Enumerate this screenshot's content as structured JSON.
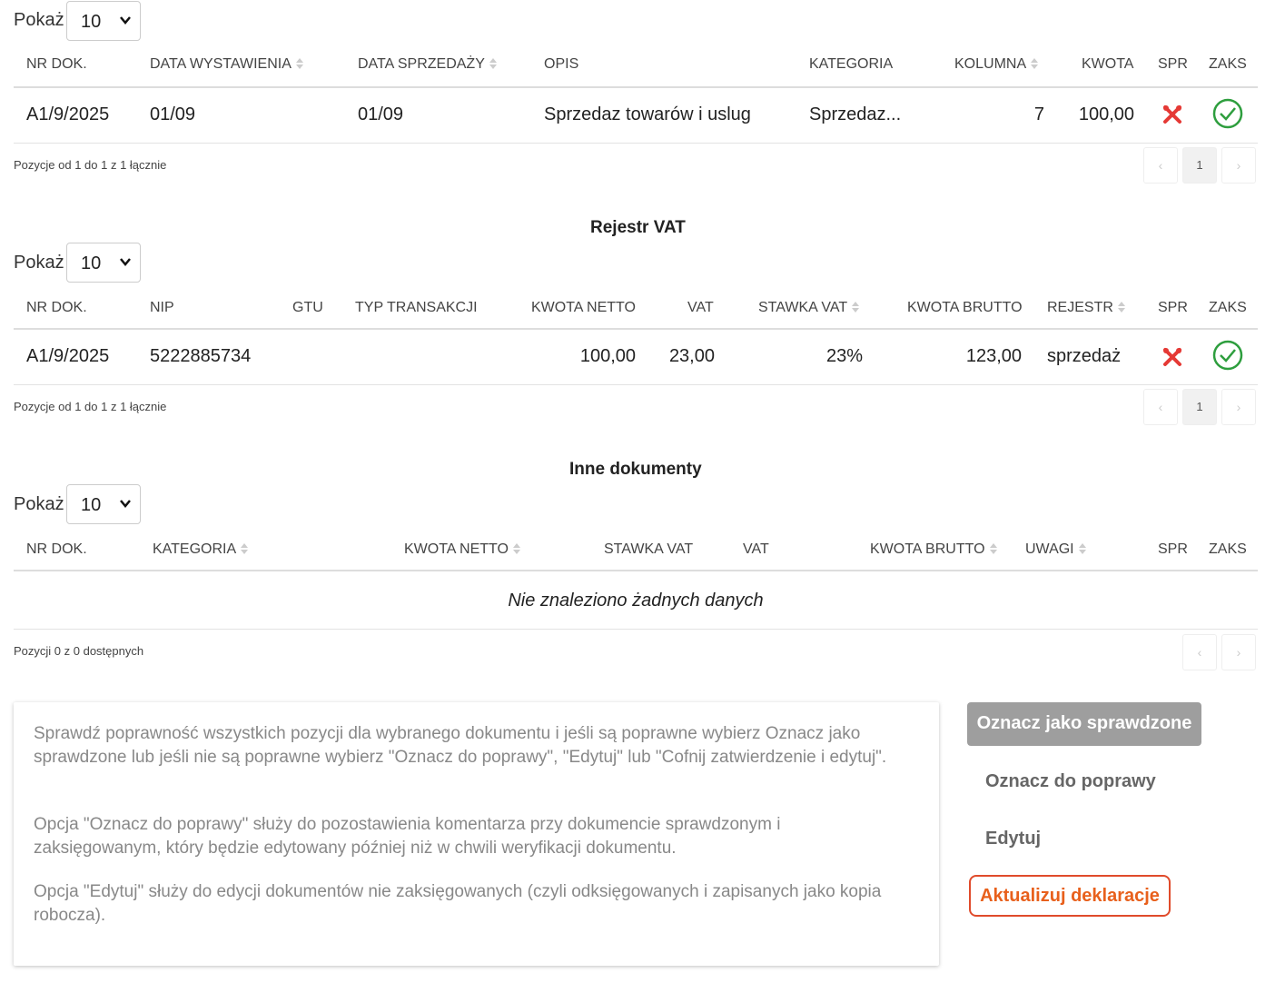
{
  "show_label": "Pokaż",
  "page_size": "10",
  "table1": {
    "headers": [
      "NR DOK.",
      "DATA WYSTAWIENIA",
      "DATA SPRZEDAŻY",
      "OPIS",
      "KATEGORIA",
      "KOLUMNA",
      "KWOTA",
      "SPR",
      "ZAKS"
    ],
    "row": {
      "nr": "A1/9/2025",
      "data_wyst": "01/09",
      "data_sprz": "01/09",
      "opis": "Sprzedaz towarów i uslug",
      "kategoria": "Sprzedaz...",
      "kolumna": "7",
      "kwota": "100,00"
    },
    "info": "Pozycje od 1 do 1 z 1 łącznie",
    "page": "1"
  },
  "table2": {
    "title": "Rejestr VAT",
    "headers": [
      "NR DOK.",
      "NIP",
      "GTU",
      "TYP TRANSAKCJI",
      "KWOTA NETTO",
      "VAT",
      "STAWKA VAT",
      "KWOTA BRUTTO",
      "REJESTR",
      "SPR",
      "ZAKS"
    ],
    "row": {
      "nr": "A1/9/2025",
      "nip": "5222885734",
      "netto": "100,00",
      "vat": "23,00",
      "stawka": "23%",
      "brutto": "123,00",
      "rejestr": "sprzedaż"
    },
    "info": "Pozycje od 1 do 1 z 1 łącznie",
    "page": "1"
  },
  "table3": {
    "title": "Inne dokumenty",
    "headers": [
      "NR DOK.",
      "KATEGORIA",
      "KWOTA NETTO",
      "STAWKA VAT",
      "VAT",
      "KWOTA BRUTTO",
      "UWAGI",
      "SPR",
      "ZAKS"
    ],
    "empty": "Nie znaleziono żadnych danych",
    "info": "Pozycji 0 z 0 dostępnych"
  },
  "infobox": {
    "p1": "Sprawdź poprawność wszystkich pozycji dla wybranego dokumentu i jeśli są poprawne wybierz Oznacz jako sprawdzone lub jeśli nie są poprawne wybierz \"Oznacz do poprawy\", \"Edytuj\" lub \"Cofnij zatwierdzenie i edytuj\".",
    "p2": "Opcja \"Oznacz do poprawy\" służy do pozostawienia komentarza przy dokumencie sprawdzonym i zaksięgowanym, który będzie edytowany później niż w chwili weryfikacji dokumentu.",
    "p3": "Opcja \"Edytuj\" służy do edycji dokumentów nie zaksięgowanych (czyli odksięgowanych i zapisanych jako kopia robocza)."
  },
  "actions": {
    "mark_checked": "Oznacz jako sprawdzone",
    "mark_fix": "Oznacz do poprawy",
    "edit": "Edytuj",
    "update_declaration": "Aktualizuj deklaracje"
  },
  "icons": {
    "spr": "tools-cross-icon",
    "zaks": "check-circle-icon"
  },
  "colors": {
    "spr_red": "#e53935",
    "zaks_green": "#2e9e3e",
    "accent_orange": "#e8601c",
    "grey_button": "#9e9e9e"
  }
}
